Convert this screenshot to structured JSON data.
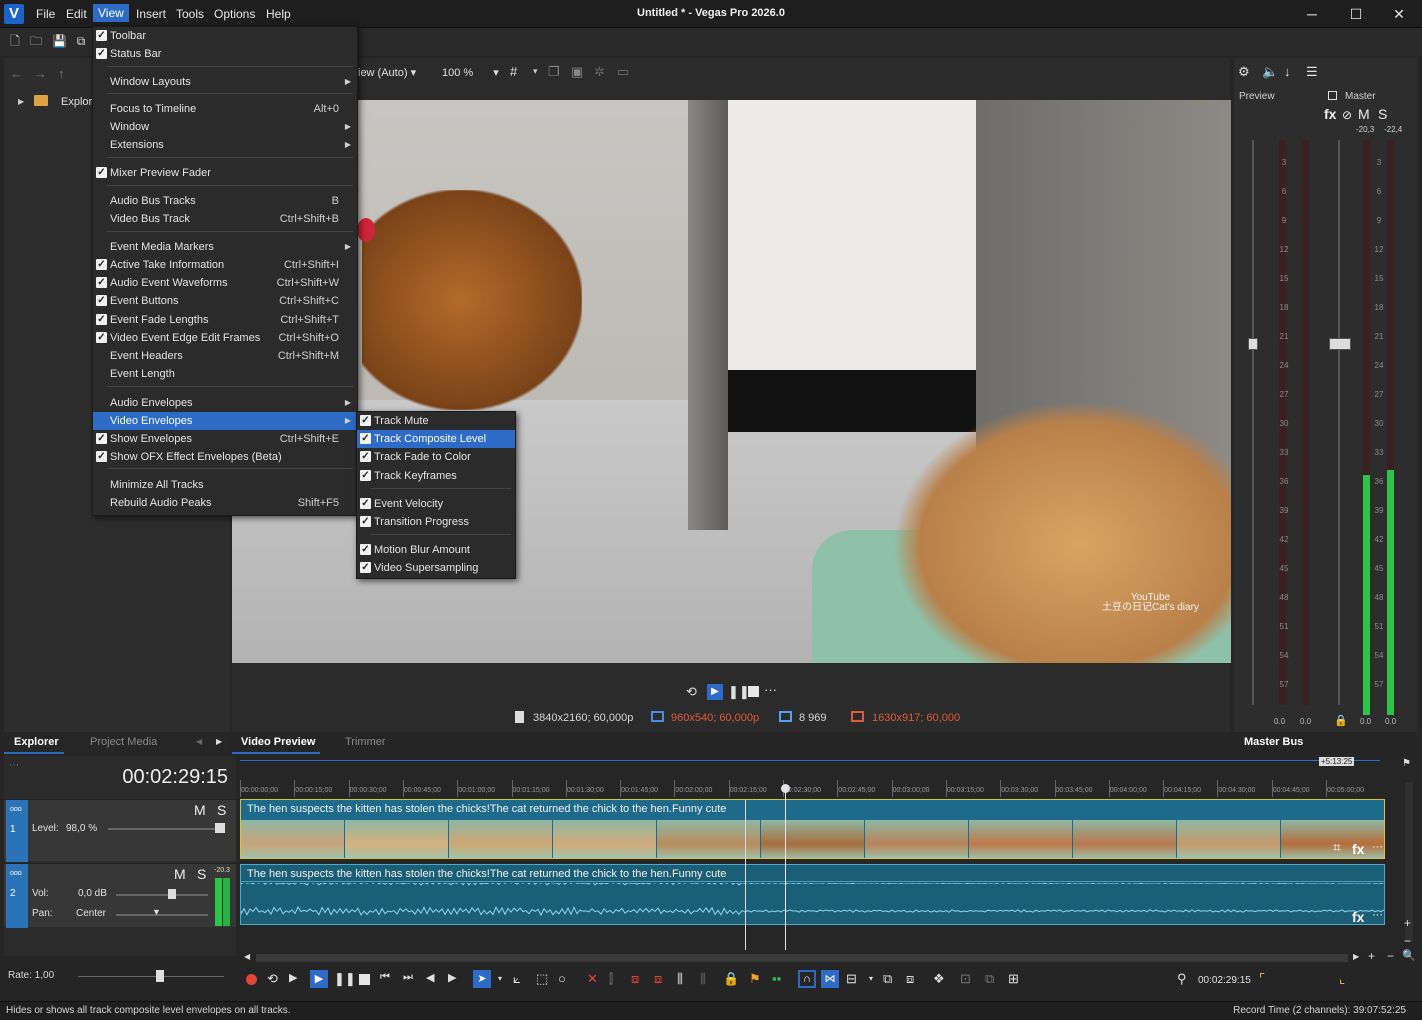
{
  "window": {
    "title": "Untitled * - Vegas Pro 2026.0",
    "app_icon": "V",
    "minimize": "─",
    "maximize": "☐",
    "close": "✕"
  },
  "menubar": {
    "items": [
      "File",
      "Edit",
      "View",
      "Insert",
      "Tools",
      "Options",
      "Help"
    ],
    "active": "View"
  },
  "view_menu": {
    "items": [
      {
        "label": "Toolbar",
        "checked": true,
        "shortcut": "",
        "submenu": false
      },
      {
        "label": "Status Bar",
        "checked": true,
        "shortcut": "",
        "submenu": false
      },
      {
        "label": "Window Layouts",
        "checked": false,
        "shortcut": "",
        "submenu": true
      },
      {
        "label": "Focus to Timeline",
        "checked": false,
        "shortcut": "Alt+0",
        "submenu": false
      },
      {
        "label": "Window",
        "checked": false,
        "shortcut": "",
        "submenu": true
      },
      {
        "label": "Extensions",
        "checked": false,
        "shortcut": "",
        "submenu": true
      },
      {
        "label": "Mixer Preview Fader",
        "checked": true,
        "shortcut": "",
        "submenu": false
      },
      {
        "label": "Audio Bus Tracks",
        "checked": false,
        "shortcut": "B",
        "submenu": false
      },
      {
        "label": "Video Bus Track",
        "checked": false,
        "shortcut": "Ctrl+Shift+B",
        "submenu": false
      },
      {
        "label": "Event Media Markers",
        "checked": false,
        "shortcut": "",
        "submenu": true
      },
      {
        "label": "Active Take Information",
        "checked": true,
        "shortcut": "Ctrl+Shift+I",
        "submenu": false
      },
      {
        "label": "Audio Event Waveforms",
        "checked": true,
        "shortcut": "Ctrl+Shift+W",
        "submenu": false
      },
      {
        "label": "Event Buttons",
        "checked": true,
        "shortcut": "Ctrl+Shift+C",
        "submenu": false
      },
      {
        "label": "Event Fade Lengths",
        "checked": true,
        "shortcut": "Ctrl+Shift+T",
        "submenu": false
      },
      {
        "label": "Video Event Edge Edit Frames",
        "checked": true,
        "shortcut": "Ctrl+Shift+O",
        "submenu": false
      },
      {
        "label": "Event Headers",
        "checked": false,
        "shortcut": "Ctrl+Shift+M",
        "submenu": false
      },
      {
        "label": "Event Length",
        "checked": false,
        "shortcut": "",
        "submenu": false
      },
      {
        "label": "Audio Envelopes",
        "checked": false,
        "shortcut": "",
        "submenu": true
      },
      {
        "label": "Video Envelopes",
        "checked": false,
        "shortcut": "",
        "submenu": true,
        "highlighted": true
      },
      {
        "label": "Show Envelopes",
        "checked": true,
        "shortcut": "Ctrl+Shift+E",
        "submenu": false
      },
      {
        "label": "Show OFX Effect Envelopes (Beta)",
        "checked": true,
        "shortcut": "",
        "submenu": false
      },
      {
        "label": "Minimize All Tracks",
        "checked": false,
        "shortcut": "",
        "submenu": false
      },
      {
        "label": "Rebuild Audio Peaks",
        "checked": false,
        "shortcut": "Shift+F5",
        "submenu": false
      }
    ]
  },
  "video_envelopes_submenu": {
    "items": [
      {
        "label": "Track Mute",
        "checked": true
      },
      {
        "label": "Track Composite Level",
        "checked": true,
        "highlighted": true
      },
      {
        "label": "Track Fade to Color",
        "checked": true
      },
      {
        "label": "Track Keyframes",
        "checked": true
      },
      {
        "label": "Event Velocity",
        "checked": true
      },
      {
        "label": "Transition Progress",
        "checked": true
      },
      {
        "label": "Motion Blur Amount",
        "checked": true
      },
      {
        "label": "Video Supersampling",
        "checked": true
      }
    ]
  },
  "explorer": {
    "tree_item": "Explore",
    "tabs": [
      "Explorer",
      "Project Media"
    ]
  },
  "preview": {
    "quality": "iew (Auto)",
    "zoom": "100 %",
    "watermark_line1": "YouTube",
    "watermark_line2": "土豆の日记Cat's diary",
    "info": {
      "project": "3840x2160; 60,000p",
      "preview": "960x540; 60,000p",
      "frame": "8 969",
      "display": "1630x917; 60,000"
    },
    "tabs": [
      "Video Preview",
      "Trimmer"
    ]
  },
  "meters": {
    "preview_label": "Preview",
    "master_label": "Master",
    "fx": "fx",
    "m": "M",
    "s": "S",
    "peak_left": "-20,3",
    "peak_right": "-22,4",
    "scale": [
      "3",
      "6",
      "9",
      "12",
      "15",
      "18",
      "21",
      "24",
      "27",
      "30",
      "33",
      "36",
      "39",
      "42",
      "45",
      "48",
      "51",
      "54",
      "57"
    ],
    "bottom_values": [
      "0.0",
      "0.0",
      "0.0",
      "0.0"
    ],
    "tab": "Master Bus"
  },
  "timeline": {
    "timecode": "00:02:29:15",
    "length_badge": "+5:13:25",
    "ruler": [
      "00:00:00;00",
      "00:00:15;00",
      "00:00:30;00",
      "00:00:45;00",
      "00:01:00;00",
      "00:01:15;00",
      "00:01:30;00",
      "00:01:45;00",
      "00:02:00;00",
      "00:02:15;00",
      "00:02:30;00",
      "00:02:45;00",
      "00:03:00;00",
      "00:03:15;00",
      "00:03:30;00",
      "00:03:45;00",
      "00:04:00;00",
      "00:04:15;00",
      "00:04:30;00",
      "00:04:45;00",
      "00:05:00;00"
    ],
    "video_track": {
      "number": "1",
      "m": "M",
      "s": "S",
      "level_label": "Level:",
      "level_value": "98,0 %",
      "event_title": "The hen suspects the kitten has stolen the chicks!The cat returned the chick to the hen.Funny cute",
      "fx": "fx"
    },
    "audio_track": {
      "number": "2",
      "m": "M",
      "s": "S",
      "peak": "-20.3",
      "vol_label": "Vol:",
      "vol_value": "0,0 dB",
      "pan_label": "Pan:",
      "pan_value": "Center",
      "event_title": "The hen suspects the kitten has stolen the chicks!The cat returned the chick to the hen.Funny cute",
      "fx": "fx"
    },
    "rate_label": "Rate: 1,00",
    "cursor_time": "00:02:29:15"
  },
  "statusbar": {
    "hint": "Hides or shows all track composite level envelopes on all tracks.",
    "record_time": "Record Time (2 channels): 39:07:52:25"
  },
  "colors": {
    "accent": "#2e6bc6",
    "video_event": "#1e6a8a",
    "audio_event": "#1b5f76",
    "meter_green": "#2ec44a",
    "warning_text": "#e05a3a"
  }
}
